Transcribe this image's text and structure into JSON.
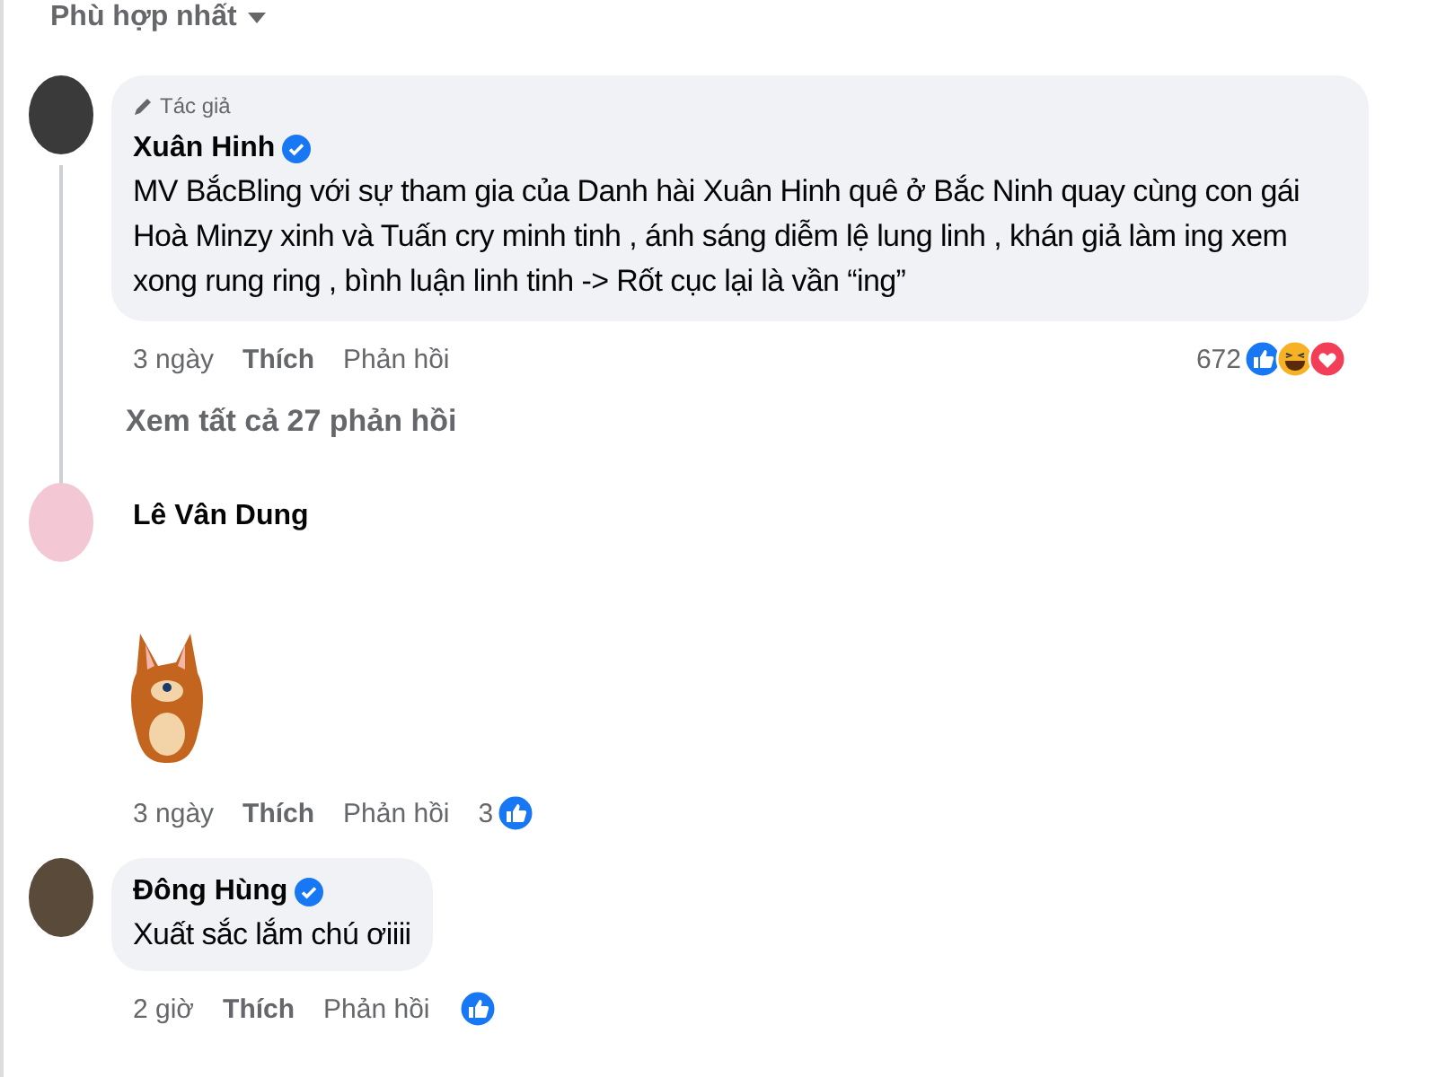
{
  "sort": {
    "label": "Phù hợp nhất"
  },
  "comments": [
    {
      "kind": "text",
      "name": "Xuân Hinh",
      "author_badge": "Tác giả",
      "verified": true,
      "text": "MV BắcBling với sự tham gia của Danh hài Xuân Hinh quê ở Bắc Ninh quay cùng con gái Hoà Minzy xinh và Tuấn cry minh tinh , ánh sáng diễm lệ lung linh , khán giả làm ing xem xong rung ring , bình luận linh tinh -> Rốt cục lại là vần “ing”",
      "time": "3 ngày",
      "like": "Thích",
      "reply": "Phản hồi",
      "reaction_count": "672",
      "reactions": [
        {
          "kind": "like"
        },
        {
          "kind": "haha"
        },
        {
          "kind": "love"
        }
      ],
      "view_replies": "Xem tất cả 27 phản hồi"
    },
    {
      "kind": "sticker",
      "name": "Lê Vân Dung",
      "verified": false,
      "time": "3 ngày",
      "like": "Thích",
      "reply": "Phản hồi",
      "reaction_count": "3",
      "reactions": [
        {
          "kind": "like"
        }
      ]
    },
    {
      "kind": "text",
      "name": "Đông Hùng",
      "verified": true,
      "text": "Xuất sắc lắm chú ơiiii",
      "time": "2 giờ",
      "like": "Thích",
      "reply": "Phản hồi",
      "reactions": [
        {
          "kind": "like"
        }
      ]
    }
  ]
}
